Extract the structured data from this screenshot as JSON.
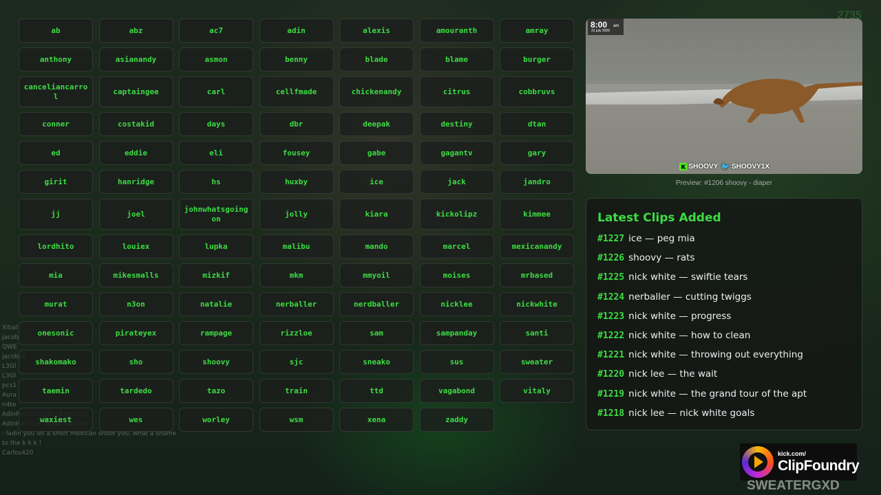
{
  "streamers": [
    "ab",
    "abz",
    "ac7",
    "adin",
    "alexis",
    "amouranth",
    "amray",
    "anthony",
    "asianandy",
    "asmon",
    "benny",
    "blade",
    "blame",
    "burger",
    "canceliancarrol",
    "captaingee",
    "carl",
    "cellfmade",
    "chickenandy",
    "citrus",
    "cobbruvs",
    "conner",
    "costakid",
    "days",
    "dbr",
    "deepak",
    "destiny",
    "dtan",
    "ed",
    "eddie",
    "eli",
    "fousey",
    "gabe",
    "gagantv",
    "gary",
    "girit",
    "hanridge",
    "hs",
    "huxby",
    "ice",
    "jack",
    "jandro",
    "jj",
    "joel",
    "johnwhatsgoingon",
    "jolly",
    "kiara",
    "kickolipz",
    "kimmee",
    "lordhito",
    "louiex",
    "lupka",
    "malibu",
    "mando",
    "marcel",
    "mexicanandy",
    "mia",
    "mikesmalls",
    "mizkif",
    "mkm",
    "mmyoil",
    "moises",
    "mrbased",
    "murat",
    "n3on",
    "natalie",
    "nerballer",
    "nerdballer",
    "nicklee",
    "nickwhite",
    "onesonic",
    "pirateyex",
    "rampage",
    "rizzloe",
    "sam",
    "sampanday",
    "santi",
    "shakomako",
    "sho",
    "shoovy",
    "sjc",
    "sneako",
    "sus",
    "sweater",
    "taemin",
    "tardedo",
    "tazo",
    "train",
    "ttd",
    "vagabond",
    "vitaly",
    "waxiest",
    "wes",
    "worley",
    "wsm",
    "xena",
    "zaddy"
  ],
  "preview": {
    "time": "8:00",
    "ampm": "am",
    "date": "31 july 2026",
    "watermark_kick": "SHOOVY",
    "watermark_twitter": "SHOOVY1X",
    "caption": "Preview: #1206 shoovy - diaper"
  },
  "latest": {
    "title": "Latest Clips Added",
    "clips": [
      {
        "num": "#1227",
        "text": "ice — peg mia"
      },
      {
        "num": "#1226",
        "text": "shoovy — rats"
      },
      {
        "num": "#1225",
        "text": "nick white — swiftie tears"
      },
      {
        "num": "#1224",
        "text": "nerballer — cutting twiggs"
      },
      {
        "num": "#1223",
        "text": "nick white — progress"
      },
      {
        "num": "#1222",
        "text": "nick white — how to clean"
      },
      {
        "num": "#1221",
        "text": "nick white — throwing out everything"
      },
      {
        "num": "#1220",
        "text": "nick lee — the wait"
      },
      {
        "num": "#1219",
        "text": "nick white — the grand tour of the apt"
      },
      {
        "num": "#1218",
        "text": "nick lee — nick white goals"
      }
    ]
  },
  "logo": {
    "small": "kick.com/",
    "big": "ClipFoundry"
  },
  "overlay": {
    "corner_text": "2735",
    "handle": "SWEATERGXD",
    "chat": [
      "Xibal",
      "jacob",
      "QWE",
      "jacob4k",
      "L3Gl",
      "L3Gl",
      "pcs1",
      "Aura",
      "n4te",
      "AdinRossStepSis : it missed",
      "AdinHairline : Show hairline",
      ": ladin you let a short mexican shoot you, what a shame",
      "to the k k k !",
      "Carlos420"
    ]
  },
  "colors": {
    "accent": "#3ddc43",
    "panel": "#1c1e1d"
  }
}
